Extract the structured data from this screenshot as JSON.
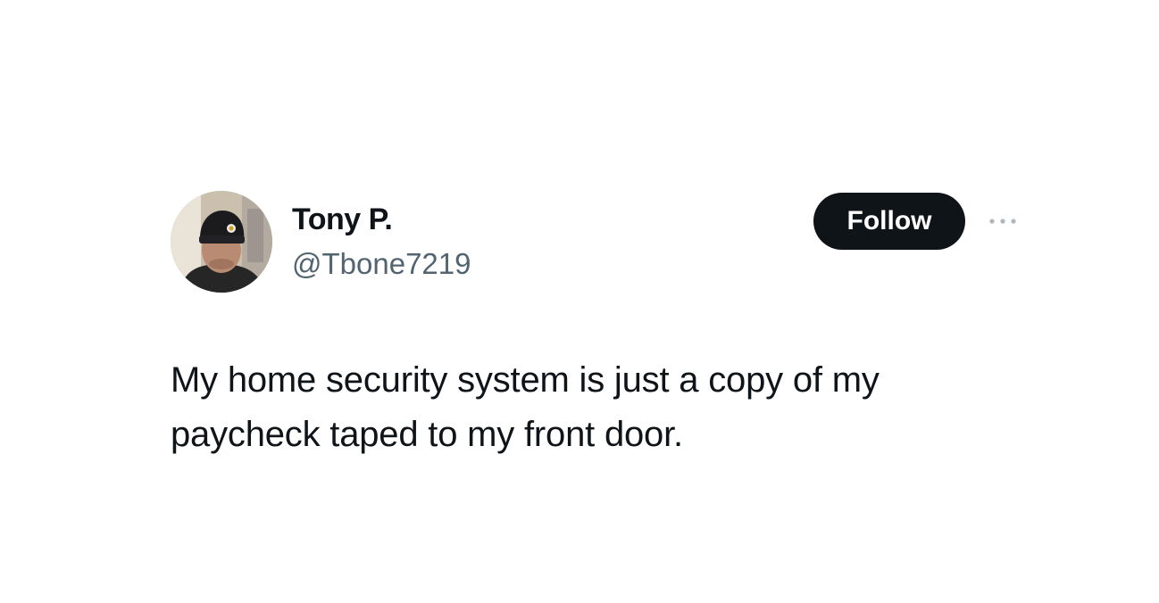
{
  "tweet": {
    "author": {
      "name": "Tony P.",
      "handle": "@Tbone7219"
    },
    "follow_label": "Follow",
    "more_icon": "more-horizontal-icon",
    "text": "My home security system is just a copy of my paycheck taped to my front door."
  },
  "colors": {
    "text_primary": "#0f1419",
    "text_secondary": "#536471",
    "button_bg": "#0f1419",
    "button_text": "#ffffff",
    "background": "#ffffff"
  }
}
